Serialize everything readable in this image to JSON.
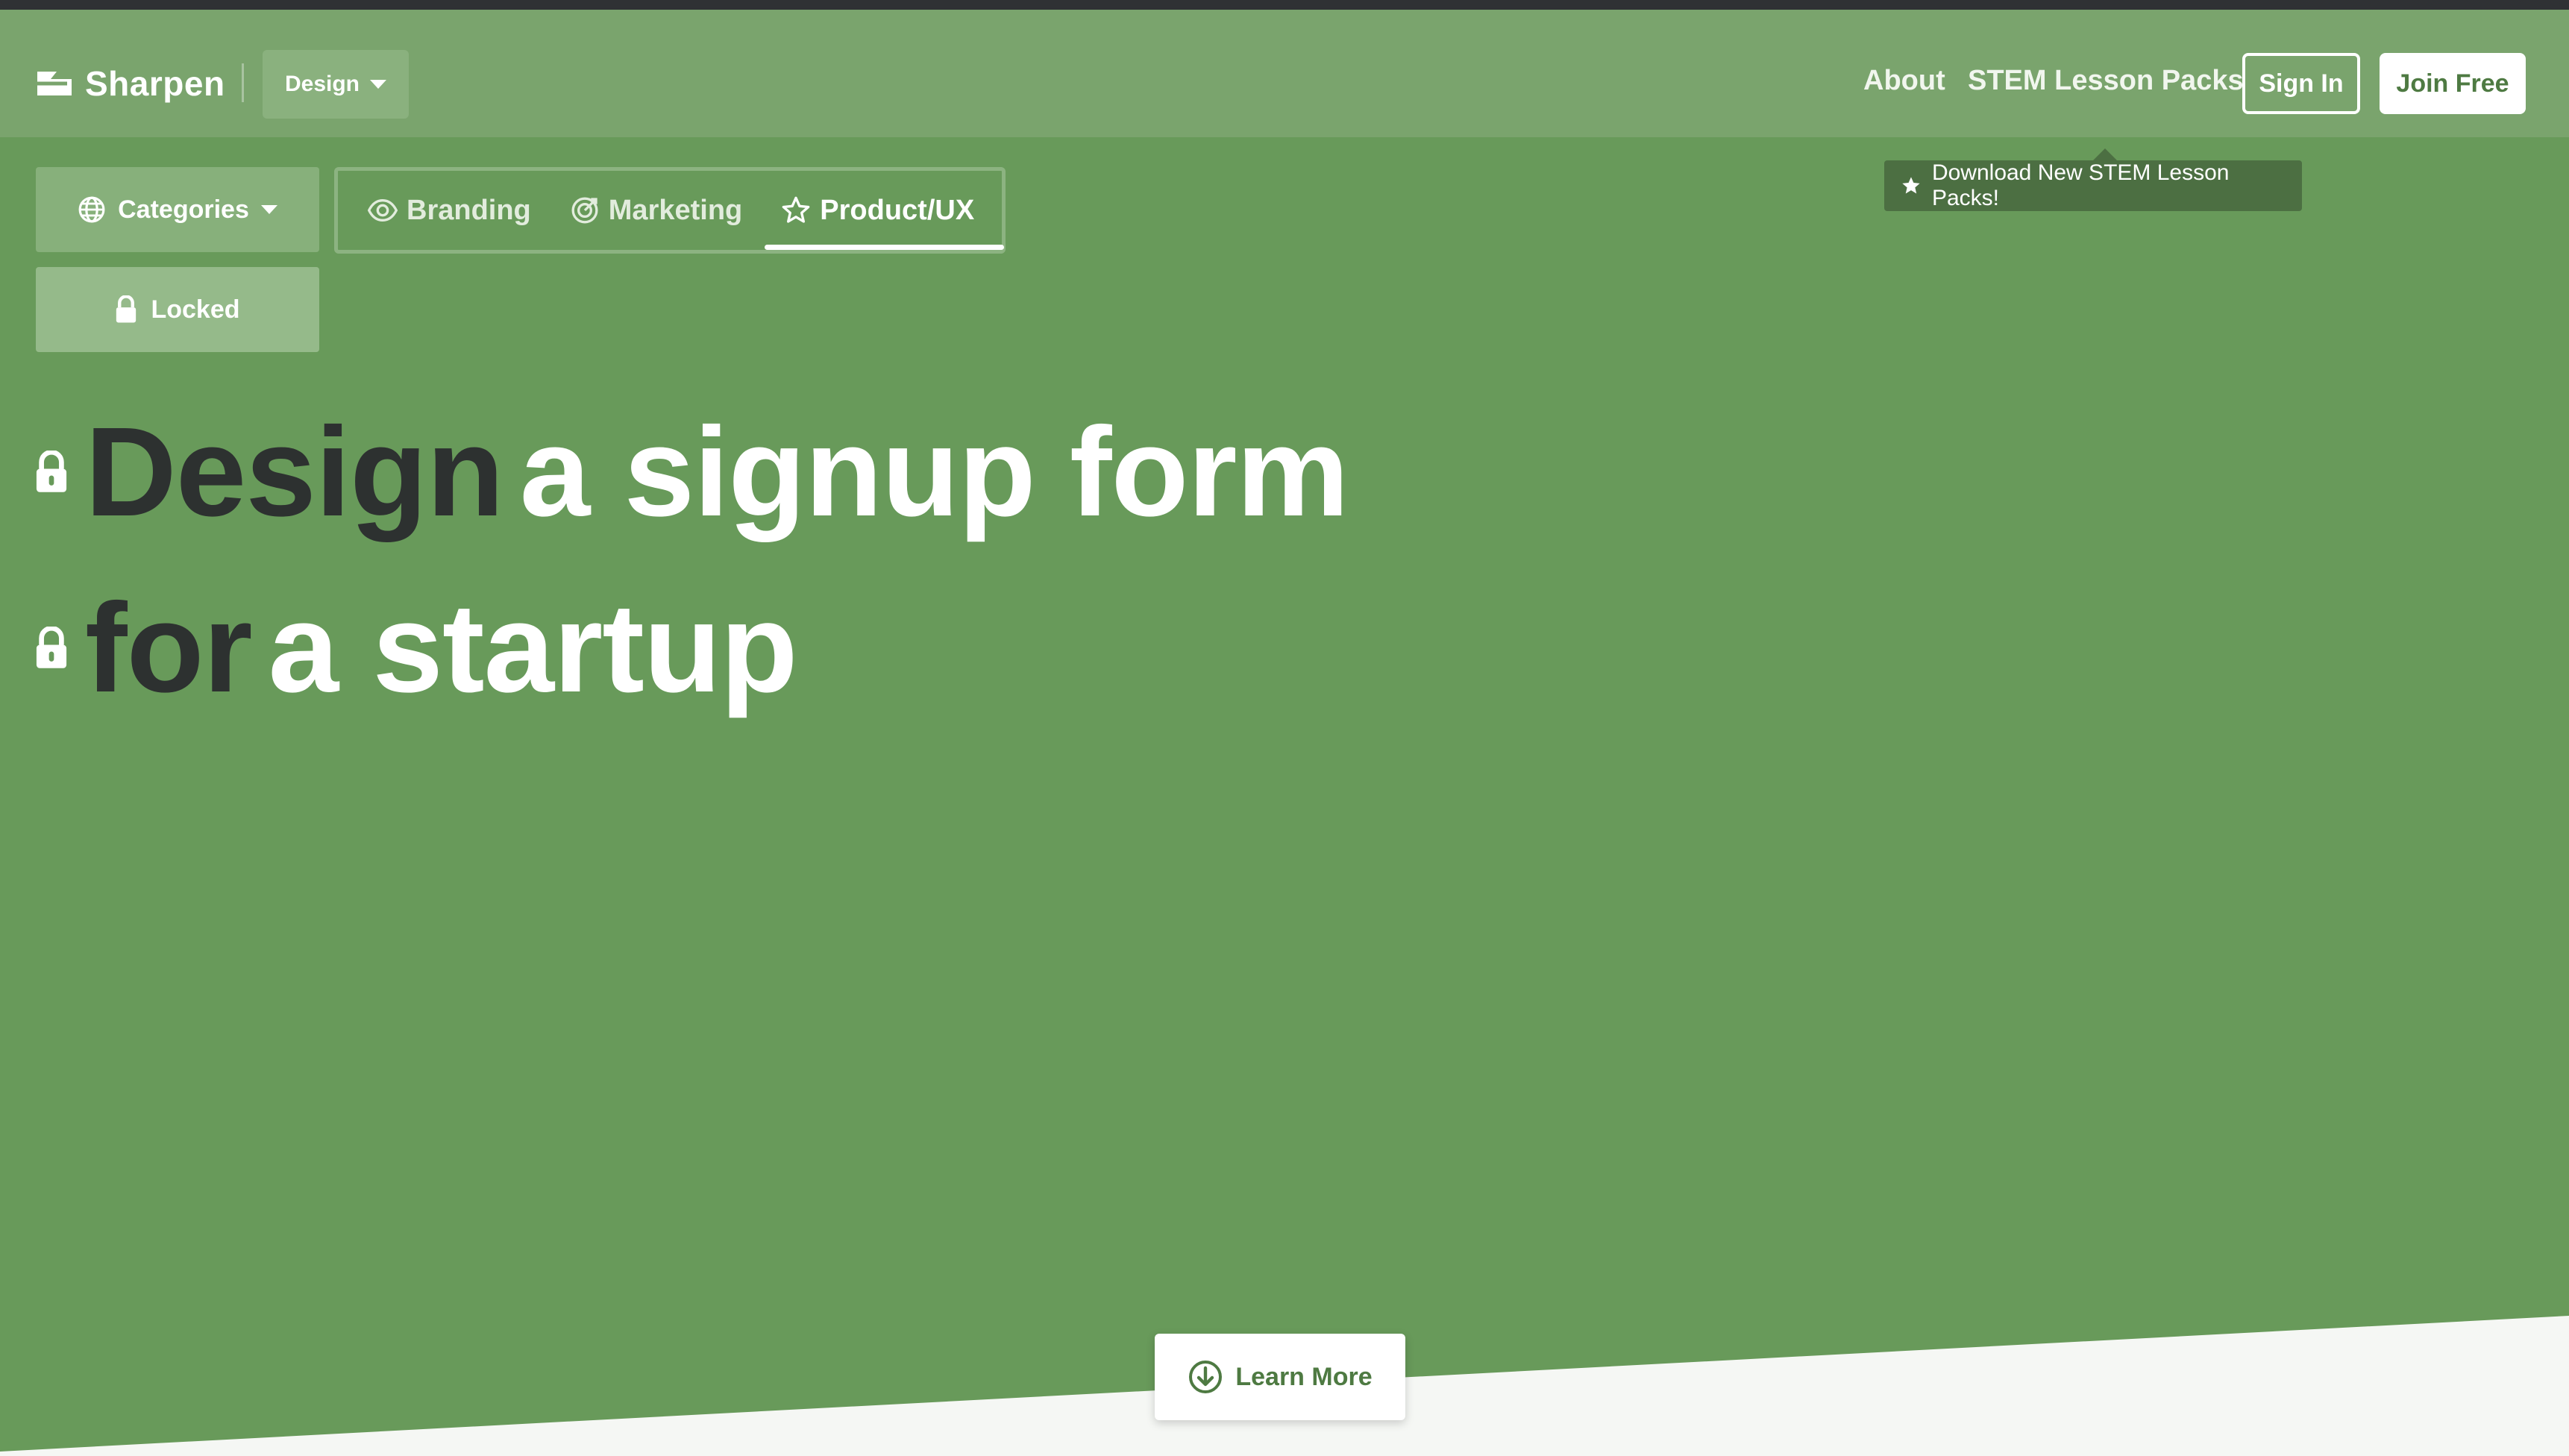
{
  "header": {
    "logo_text": "Sharpen",
    "section_dropdown_label": "Design",
    "nav": {
      "about": "About",
      "stem_lesson_packs": "STEM Lesson Packs",
      "sign_in": "Sign In",
      "join_free": "Join Free"
    }
  },
  "tooltip": {
    "text": "Download New STEM Lesson Packs!",
    "icon": "star-icon"
  },
  "filters": {
    "categories_label": "Categories",
    "tabs": [
      {
        "label": "Branding",
        "icon": "eye-icon",
        "active": false
      },
      {
        "label": "Marketing",
        "icon": "target-icon",
        "active": false
      },
      {
        "label": "Product/UX",
        "icon": "star-icon",
        "active": true
      }
    ],
    "locked_label": "Locked"
  },
  "prompt": {
    "line1": {
      "dark": "Design",
      "light": "a signup form"
    },
    "line2": {
      "dark": "for",
      "light": "a startup"
    }
  },
  "learn_more": {
    "label": "Learn More",
    "icon": "download-circle-icon"
  },
  "colors": {
    "background_green": "#689a5a",
    "header_green": "#7aa46d",
    "dark_text": "#2d3130",
    "accent_green": "#4e7a42",
    "top_strip": "#2f3134",
    "bottom_area": "#f5f7f4"
  }
}
